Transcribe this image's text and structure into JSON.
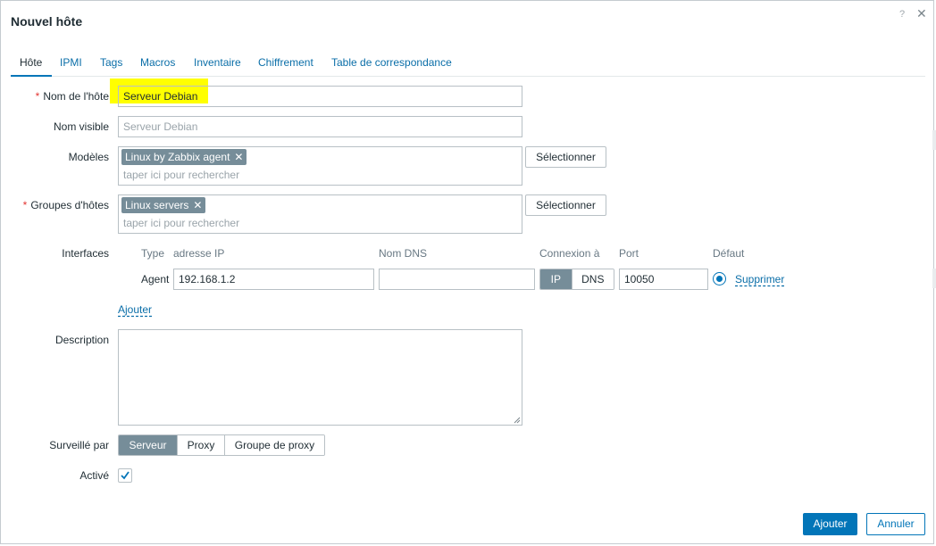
{
  "dialog": {
    "title": "Nouvel hôte",
    "help_symbol": "?",
    "close_symbol": "✕"
  },
  "tabs": [
    {
      "label": "Hôte",
      "active": true
    },
    {
      "label": "IPMI"
    },
    {
      "label": "Tags"
    },
    {
      "label": "Macros"
    },
    {
      "label": "Inventaire"
    },
    {
      "label": "Chiffrement"
    },
    {
      "label": "Table de correspondance"
    }
  ],
  "form": {
    "required_mark": "*",
    "host_name": {
      "label": "Nom de l'hôte",
      "value": "Serveur Debian"
    },
    "visible_name": {
      "label": "Nom visible",
      "placeholder": "Serveur Debian"
    },
    "templates": {
      "label": "Modèles",
      "chips": [
        "Linux by Zabbix agent"
      ],
      "placeholder": "taper ici pour rechercher",
      "select_button": "Sélectionner"
    },
    "host_groups": {
      "label": "Groupes d'hôtes",
      "chips": [
        "Linux servers"
      ],
      "placeholder": "taper ici pour rechercher",
      "select_button": "Sélectionner"
    },
    "interfaces": {
      "label": "Interfaces",
      "headers": {
        "type": "Type",
        "ip": "adresse IP",
        "dns": "Nom DNS",
        "connect": "Connexion à",
        "port": "Port",
        "default": "Défaut"
      },
      "row": {
        "type": "Agent",
        "ip": "192.168.1.2",
        "dns": "",
        "connect_options": [
          "IP",
          "DNS"
        ],
        "connect_selected": "IP",
        "port": "10050",
        "default_selected": true,
        "remove_link": "Supprimer"
      },
      "add_link": "Ajouter"
    },
    "description": {
      "label": "Description",
      "value": ""
    },
    "monitored_by": {
      "label": "Surveillé par",
      "options": [
        "Serveur",
        "Proxy",
        "Groupe de proxy"
      ],
      "selected": "Serveur"
    },
    "enabled": {
      "label": "Activé",
      "checked": true
    }
  },
  "footer": {
    "add_button": "Ajouter",
    "cancel_button": "Annuler"
  },
  "colors": {
    "accent": "#0275b8",
    "link": "#0a6ea8",
    "chip": "#768d99",
    "highlight": "#ffff00",
    "required": "#e33734"
  }
}
